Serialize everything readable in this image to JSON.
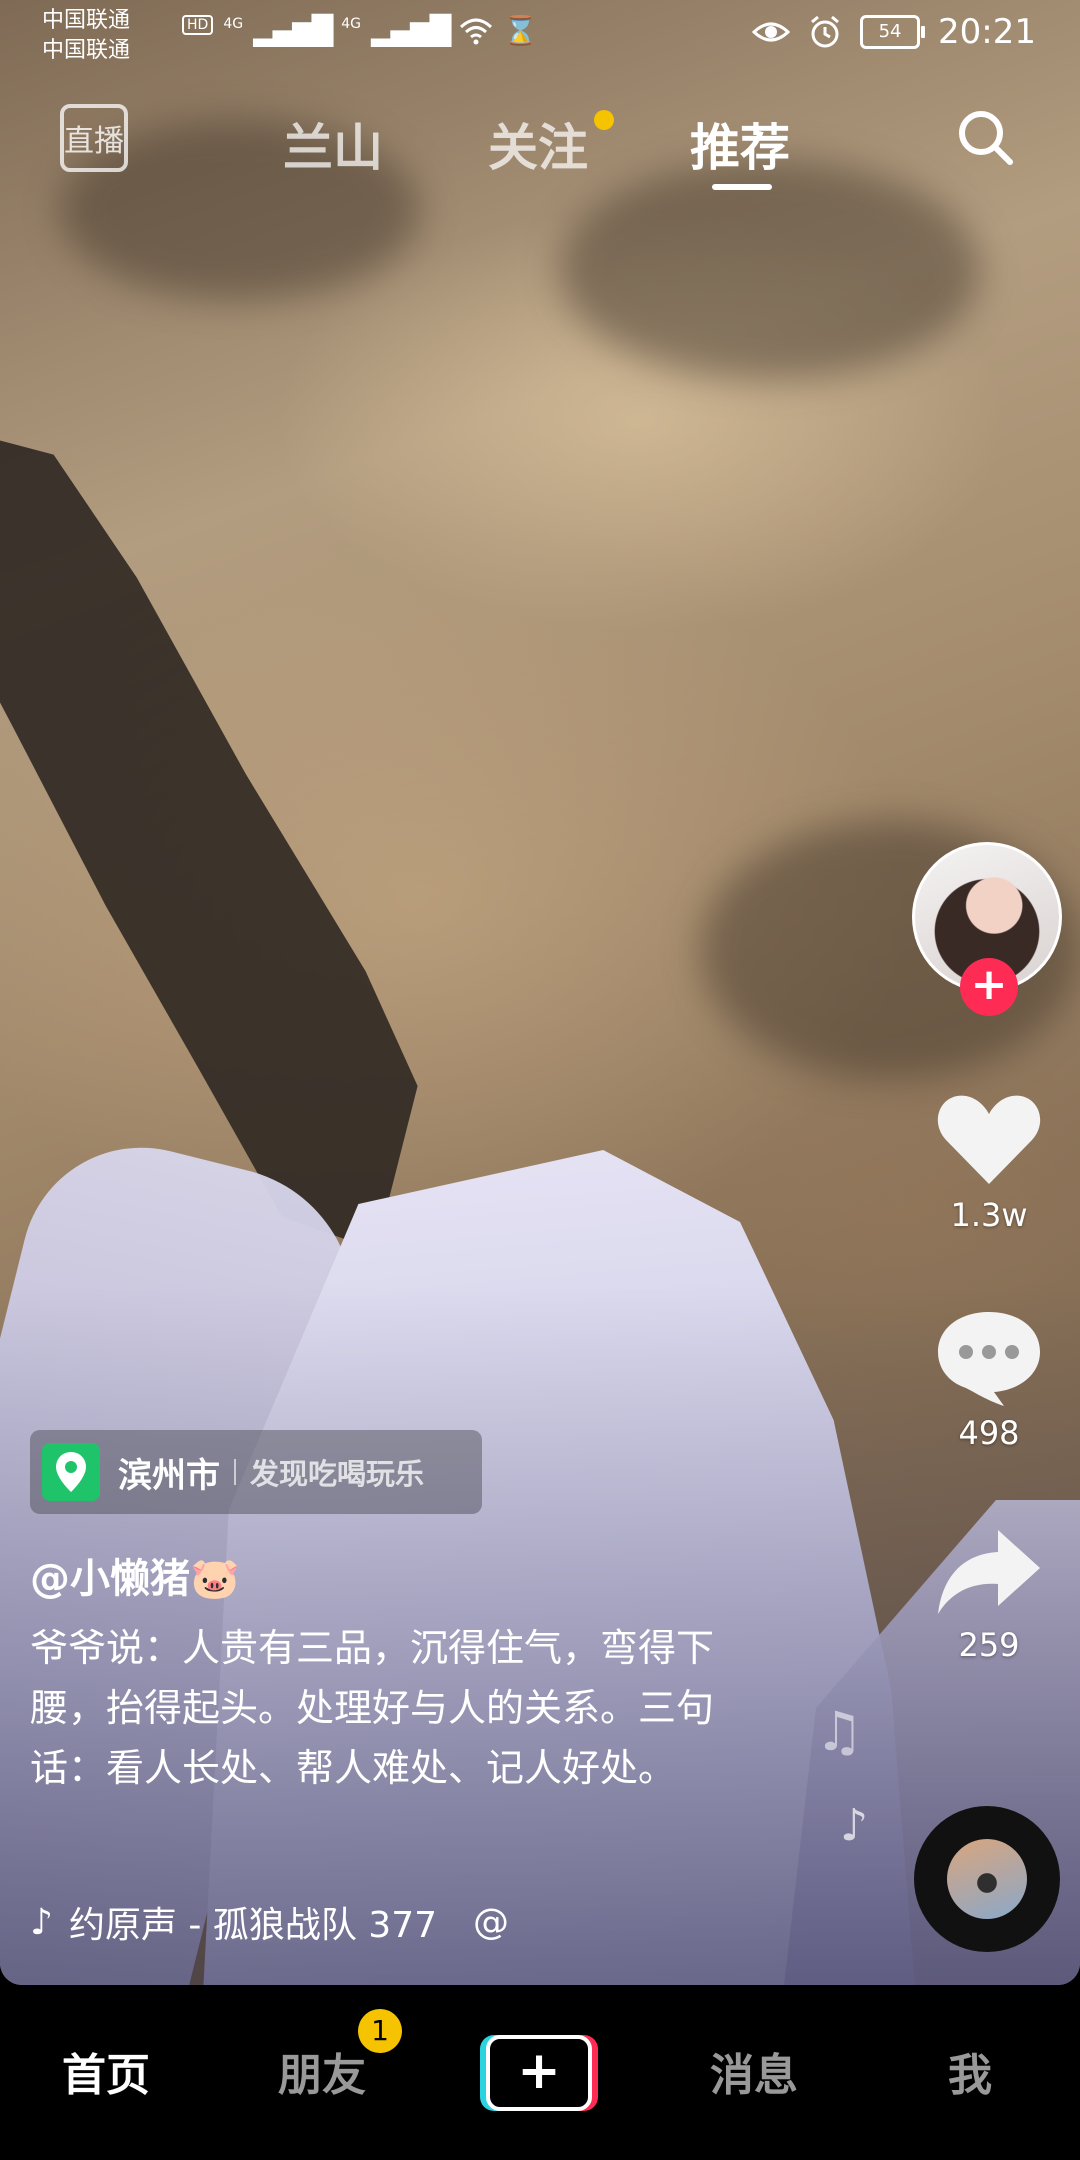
{
  "status_bar": {
    "carrier_1": "中国联通",
    "carrier_2": "中国联通",
    "hd": "HD",
    "network_1": "4G",
    "network_2": "4G",
    "battery": "54",
    "time": "20:21"
  },
  "top_nav": {
    "live_label": "直播",
    "tabs": [
      {
        "label": "兰山",
        "active": false
      },
      {
        "label": "关注",
        "active": false,
        "has_dot": true
      },
      {
        "label": "推荐",
        "active": true
      }
    ]
  },
  "right_rail": {
    "like_count": "1.3w",
    "comment_count": "498",
    "share_count": "259"
  },
  "video_info": {
    "location_city": "滨州市",
    "location_sub": "发现吃喝玩乐",
    "author": "@小懒猪🐷",
    "caption": "爷爷说：人贵有三品，沉得住气，弯得下腰，抬得起头。处理好与人的关系。三句话：看人长处、帮人难处、记人好处。",
    "music": "约原声 - 孤狼战队  377",
    "music_tail": "@"
  },
  "tab_bar": {
    "home": "首页",
    "friends": "朋友",
    "friends_badge": "1",
    "create": "+",
    "messages": "消息",
    "me": "我"
  },
  "colors": {
    "accent_red": "#fe2c55",
    "accent_cyan": "#2bd3e0",
    "badge_yellow": "#f6c300",
    "location_green": "#1fc46a"
  }
}
